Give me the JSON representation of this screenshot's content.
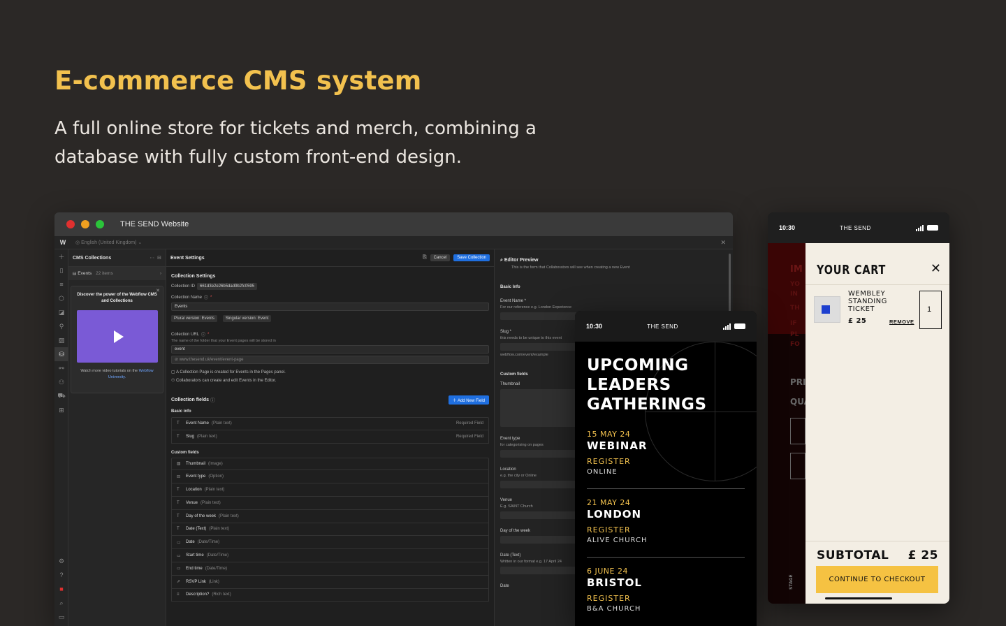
{
  "hero": {
    "title": "E-commerce CMS system",
    "subtitle": "A full online store for tickets and merch, combining a database with fully custom front-end design."
  },
  "window": {
    "title": "THE SEND Website",
    "locale": "English (United Kingdom)",
    "logo": "W"
  },
  "cms_panel": {
    "title": "CMS Collections",
    "events_label": "Events",
    "events_count": "22 items",
    "promo_title": "Discover the power of the Webflow CMS and Collections",
    "promo_body": "Watch more video tutorials on the",
    "promo_link": "Webflow University."
  },
  "settings": {
    "title": "Event Settings",
    "cancel": "Cancel",
    "save": "Save Collection",
    "section_title": "Collection Settings",
    "collection_id_label": "Collection ID",
    "collection_id": "661d3e2e26b5dad9b2fc0595",
    "collection_name_label": "Collection Name",
    "collection_name": "Events",
    "plural": "Plural version: Events",
    "singular": "Singular version: Event",
    "url_label": "Collection URL",
    "url_hint": "The name of the folder that your Event pages will be stored in",
    "url_value": "event",
    "url_full": "www.thesend.uk/event/event-page",
    "note1": "A Collection Page is created for Events in the Pages panel.",
    "note2": "Collaborators can create and edit Events in the Editor.",
    "fields_title": "Collection fields",
    "add_field": "Add New Field",
    "basic_info": "Basic info",
    "custom_fields": "Custom fields",
    "basic_fields": [
      {
        "name": "Event Name",
        "type": "(Plain text)",
        "req": "Required Field",
        "glyph": "T"
      },
      {
        "name": "Slug",
        "type": "(Plain text)",
        "req": "Required Field",
        "glyph": "T"
      }
    ],
    "custom": [
      {
        "name": "Thumbnail",
        "type": "(Image)",
        "glyph": "▧"
      },
      {
        "name": "Event type",
        "type": "(Option)",
        "glyph": "⊟"
      },
      {
        "name": "Location",
        "type": "(Plain text)",
        "glyph": "T"
      },
      {
        "name": "Venue",
        "type": "(Plain text)",
        "glyph": "T"
      },
      {
        "name": "Day of the week",
        "type": "(Plain text)",
        "glyph": "T"
      },
      {
        "name": "Date (Text)",
        "type": "(Plain text)",
        "glyph": "T"
      },
      {
        "name": "Date",
        "type": "(Date/Time)",
        "glyph": "▭"
      },
      {
        "name": "Start time",
        "type": "(Date/Time)",
        "glyph": "▭"
      },
      {
        "name": "End time",
        "type": "(Date/Time)",
        "glyph": "▭"
      },
      {
        "name": "RSVP Link",
        "type": "(Link)",
        "glyph": "⇗"
      },
      {
        "name": "Description?",
        "type": "(Rich text)",
        "glyph": "≡"
      }
    ]
  },
  "preview": {
    "title": "Editor Preview",
    "subtitle": "This is the form that Collaborators will see when creating a new Event",
    "basic_info": "Basic Info",
    "event_name": "Event Name *",
    "event_name_hint": "For our reference e.g. London Experience",
    "slug": "Slug *",
    "slug_hint": "this needs to be unique to this event",
    "slug_url": "webflow.com/event/example",
    "custom_fields": "Custom fields",
    "thumbnail": "Thumbnail",
    "event_type": "Event type",
    "event_type_hint": "for categorising on pages",
    "location": "Location",
    "location_hint": "e.g. the city or Online",
    "venue": "Venue",
    "venue_hint": "E.g. SAINT Church",
    "day": "Day of the week",
    "date_text": "Date (Text)",
    "date_text_hint": "Written in our format e.g. 17 April 24",
    "date": "Date"
  },
  "phone_events": {
    "time": "10:30",
    "brand": "THE SEND",
    "heading": [
      "UPCOMING",
      "LEADERS",
      "GATHERINGS"
    ],
    "events": [
      {
        "date": "15 MAY 24",
        "name": "WEBINAR",
        "cta": "REGISTER",
        "venue": "ONLINE"
      },
      {
        "date": "21 MAY 24",
        "name": "LONDON",
        "cta": "REGISTER",
        "venue": "ALIVE CHURCH"
      },
      {
        "date": "6 JUNE 24",
        "name": "BRISTOL",
        "cta": "REGISTER",
        "venue": "B&A CHURCH"
      }
    ]
  },
  "phone_cart": {
    "time": "10:30",
    "brand": "THE SEND",
    "title": "YOUR CART",
    "item_name": "WEMBLEY STANDING TICKET",
    "item_price": "£ 25",
    "remove": "REMOVE",
    "qty": "1",
    "subtotal_label": "SUBTOTAL",
    "subtotal": "£ 25",
    "checkout": "CONTINUE TO CHECKOUT",
    "bg_lines": [
      "IM",
      "YO",
      "IN",
      "TH",
      "IF",
      "PL",
      "FO",
      "PRI",
      "QUA"
    ],
    "bg_stage": "STAGE"
  },
  "colors": {
    "accent": "#f2c14e",
    "bg": "#2b2826",
    "blue": "#1f6fe0",
    "cart_bg": "#f3eee4"
  }
}
